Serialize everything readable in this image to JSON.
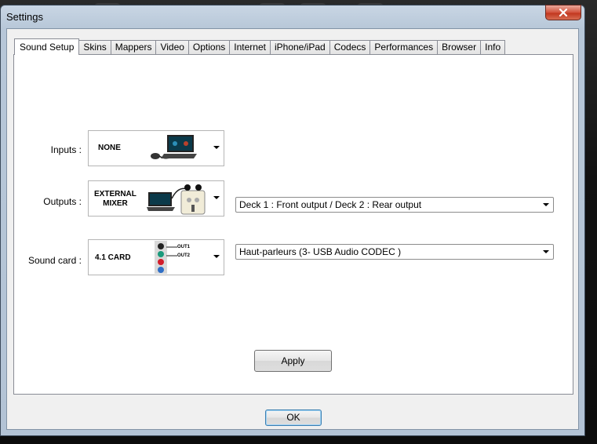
{
  "window": {
    "title": "Settings"
  },
  "tabs": [
    {
      "label": "Sound Setup",
      "active": true
    },
    {
      "label": "Skins"
    },
    {
      "label": "Mappers"
    },
    {
      "label": "Video"
    },
    {
      "label": "Options"
    },
    {
      "label": "Internet"
    },
    {
      "label": "iPhone/iPad"
    },
    {
      "label": "Codecs"
    },
    {
      "label": "Performances"
    },
    {
      "label": "Browser"
    },
    {
      "label": "Info"
    }
  ],
  "sound_setup": {
    "inputs": {
      "label": "Inputs :",
      "value": "NONE"
    },
    "outputs": {
      "label": "Outputs :",
      "value_line1": "EXTERNAL",
      "value_line2": "MIXER",
      "routing": "Deck 1 : Front output / Deck 2 : Rear output"
    },
    "sound_card": {
      "label": "Sound card :",
      "value": "4.1 CARD",
      "out1": "OUT1",
      "out2": "OUT2",
      "device": "Haut-parleurs (3- USB Audio CODEC )"
    },
    "apply_label": "Apply"
  },
  "footer": {
    "ok_label": "OK"
  },
  "colors": {
    "close_red": "#c1371f",
    "frame_blue": "#b7c7d8",
    "ok_focus": "#3c7fb1"
  }
}
